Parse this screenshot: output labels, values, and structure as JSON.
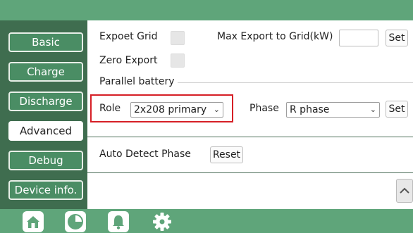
{
  "sidebar": {
    "items": [
      {
        "label": "Basic"
      },
      {
        "label": "Charge"
      },
      {
        "label": "Discharge"
      },
      {
        "label": "Advanced"
      },
      {
        "label": "Debug"
      },
      {
        "label": "Device info."
      }
    ]
  },
  "export": {
    "expoet_grid_label": "Expoet Grid",
    "max_export_label": "Max Export to Grid(kW)",
    "max_export_value": "",
    "set_label": "Set",
    "zero_export_label": "Zero Export"
  },
  "parallel": {
    "section_label": "Parallel battery",
    "role_label": "Role",
    "role_value": "2x208 primary",
    "phase_label": "Phase",
    "phase_value": "R phase",
    "set_label": "Set"
  },
  "auto_detect": {
    "label": "Auto Detect Phase",
    "reset_label": "Reset"
  },
  "bottom_nav": {
    "icons": [
      "home-icon",
      "pie-chart-icon",
      "bell-icon",
      "gear-icon"
    ]
  }
}
